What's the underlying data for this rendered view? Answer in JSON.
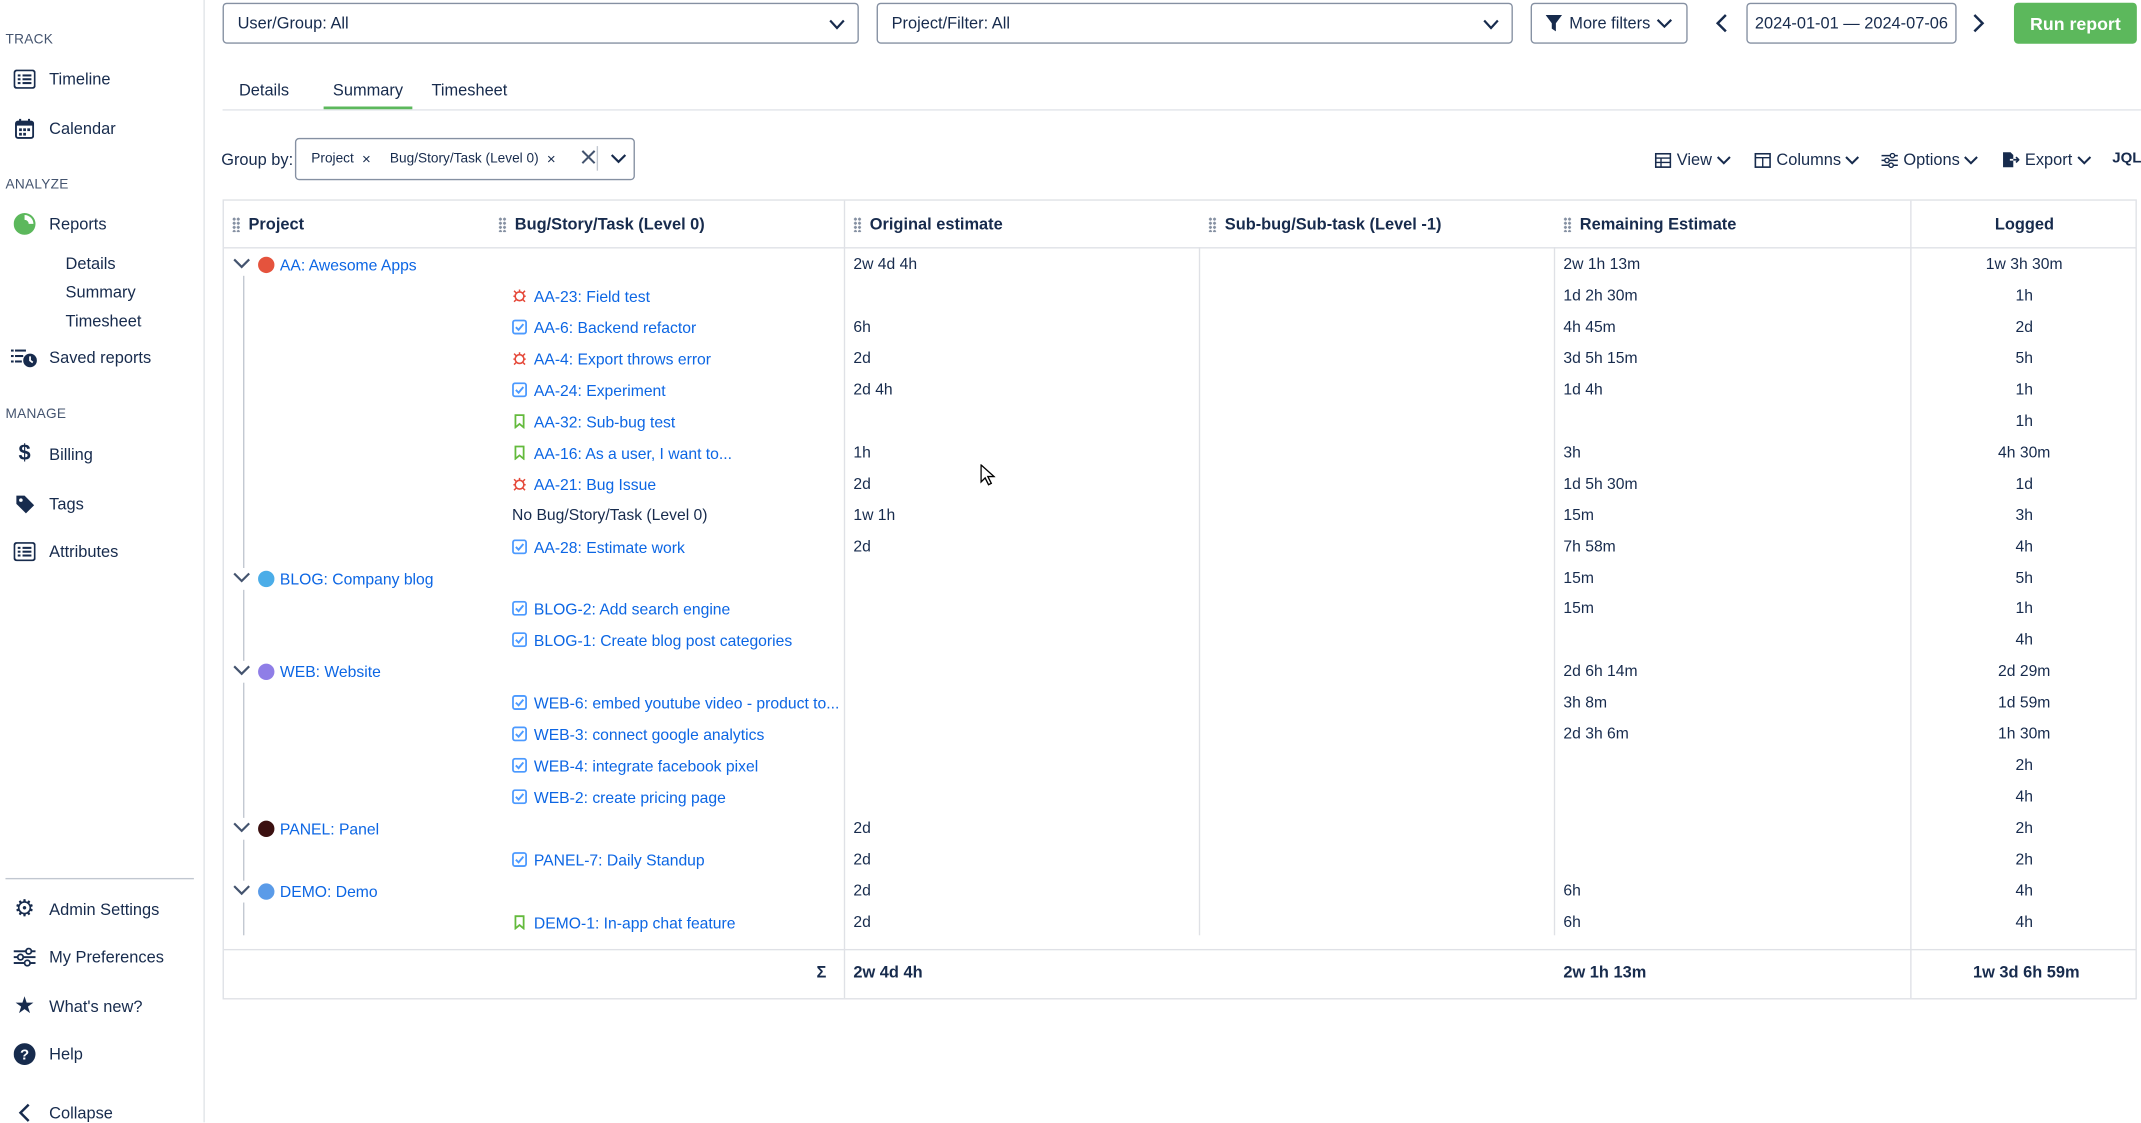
{
  "sidebar": {
    "track_label": "TRACK",
    "timeline": "Timeline",
    "calendar": "Calendar",
    "analyze_label": "ANALYZE",
    "reports": "Reports",
    "details": "Details",
    "summary": "Summary",
    "timesheet": "Timesheet",
    "saved_reports": "Saved reports",
    "manage_label": "MANAGE",
    "billing": "Billing",
    "tags": "Tags",
    "attributes": "Attributes",
    "admin_settings": "Admin Settings",
    "my_preferences": "My Preferences",
    "whats_new": "What's new?",
    "help": "Help",
    "collapse": "Collapse"
  },
  "topbar": {
    "user_group": "User/Group: All",
    "project_filter": "Project/Filter: All",
    "more_filters": "More filters",
    "date_range": "2024-01-01 — 2024-07-06",
    "run_report": "Run report"
  },
  "tabs": [
    "Details",
    "Summary",
    "Timesheet"
  ],
  "active_tab": "Summary",
  "group_by": {
    "label": "Group by:",
    "chips": [
      "Project",
      "Bug/Story/Task (Level 0)"
    ]
  },
  "toolbar": {
    "view": "View",
    "columns": "Columns",
    "options": "Options",
    "export": "Export",
    "jql": "JQL"
  },
  "table": {
    "headers": {
      "project": "Project",
      "level0": "Bug/Story/Task (Level 0)",
      "original": "Original estimate",
      "sublevel": "Sub-bug/Sub-task (Level -1)",
      "remaining": "Remaining Estimate",
      "logged": "Logged"
    },
    "rows": [
      {
        "kind": "project",
        "label": "AA: Awesome Apps",
        "avatar": "#e5533d",
        "original": "2w 4d 4h",
        "remaining": "2w 1h 13m",
        "logged": "1w 3h 30m"
      },
      {
        "kind": "issue",
        "type": "bug",
        "label": "AA-23: Field test",
        "original": "",
        "remaining": "1d 2h 30m",
        "logged": "1h"
      },
      {
        "kind": "issue",
        "type": "task",
        "label": "AA-6: Backend refactor",
        "original": "6h",
        "remaining": "4h 45m",
        "logged": "2d"
      },
      {
        "kind": "issue",
        "type": "bug",
        "label": "AA-4: Export throws error",
        "original": "2d",
        "remaining": "3d 5h 15m",
        "logged": "5h"
      },
      {
        "kind": "issue",
        "type": "task",
        "label": "AA-24: Experiment",
        "original": "2d 4h",
        "remaining": "1d 4h",
        "logged": "1h"
      },
      {
        "kind": "issue",
        "type": "story",
        "label": "AA-32: Sub-bug test",
        "original": "",
        "remaining": "",
        "logged": "1h"
      },
      {
        "kind": "issue",
        "type": "story",
        "label": "AA-16: As a user, I want to...",
        "original": "1h",
        "remaining": "3h",
        "logged": "4h 30m"
      },
      {
        "kind": "issue",
        "type": "bug",
        "label": "AA-21: Bug Issue",
        "original": "2d",
        "remaining": "1d 5h 30m",
        "logged": "1d"
      },
      {
        "kind": "plain",
        "label": "No Bug/Story/Task (Level 0)",
        "original": "1w 1h",
        "remaining": "15m",
        "logged": "3h"
      },
      {
        "kind": "issue",
        "type": "task",
        "label": "AA-28: Estimate work",
        "original": "2d",
        "remaining": "7h 58m",
        "logged": "4h"
      },
      {
        "kind": "project",
        "label": "BLOG: Company blog",
        "avatar": "#4bade8",
        "original": "",
        "remaining": "15m",
        "logged": "5h"
      },
      {
        "kind": "issue",
        "type": "task",
        "label": "BLOG-2: Add search engine",
        "original": "",
        "remaining": "15m",
        "logged": "1h"
      },
      {
        "kind": "issue",
        "type": "task",
        "label": "BLOG-1: Create blog post categories",
        "original": "",
        "remaining": "",
        "logged": "4h"
      },
      {
        "kind": "project",
        "label": "WEB: Website",
        "avatar": "#8f7ee7",
        "original": "",
        "remaining": "2d 6h 14m",
        "logged": "2d 29m"
      },
      {
        "kind": "issue",
        "type": "task",
        "label": "WEB-6: embed youtube video - product to...",
        "original": "",
        "remaining": "3h 8m",
        "logged": "1d 59m"
      },
      {
        "kind": "issue",
        "type": "task",
        "label": "WEB-3: connect google analytics",
        "original": "",
        "remaining": "2d 3h 6m",
        "logged": "1h 30m"
      },
      {
        "kind": "issue",
        "type": "task",
        "label": "WEB-4: integrate facebook pixel",
        "original": "",
        "remaining": "",
        "logged": "2h"
      },
      {
        "kind": "issue",
        "type": "task",
        "label": "WEB-2: create pricing page",
        "original": "",
        "remaining": "",
        "logged": "4h"
      },
      {
        "kind": "project",
        "label": "PANEL: Panel",
        "avatar": "#3b1010",
        "original": "2d",
        "remaining": "",
        "logged": "2h"
      },
      {
        "kind": "issue",
        "type": "task",
        "label": "PANEL-7: Daily Standup",
        "original": "2d",
        "remaining": "",
        "logged": "2h"
      },
      {
        "kind": "project",
        "label": "DEMO: Demo",
        "avatar": "#5a9be8",
        "original": "2d",
        "remaining": "6h",
        "logged": "4h"
      },
      {
        "kind": "issue",
        "type": "story",
        "label": "DEMO-1: In-app chat feature",
        "original": "2d",
        "remaining": "6h",
        "logged": "4h"
      }
    ],
    "totals": {
      "sigma": "Σ",
      "original": "2w 4d 4h",
      "remaining": "2w 1h 13m",
      "logged": "1w 3d 6h 59m"
    }
  },
  "colors": {
    "accent": "#5cb85c",
    "link": "#0c66e4",
    "bug": "#e5493a",
    "task": "#4c9aff",
    "story": "#63ba3c"
  }
}
